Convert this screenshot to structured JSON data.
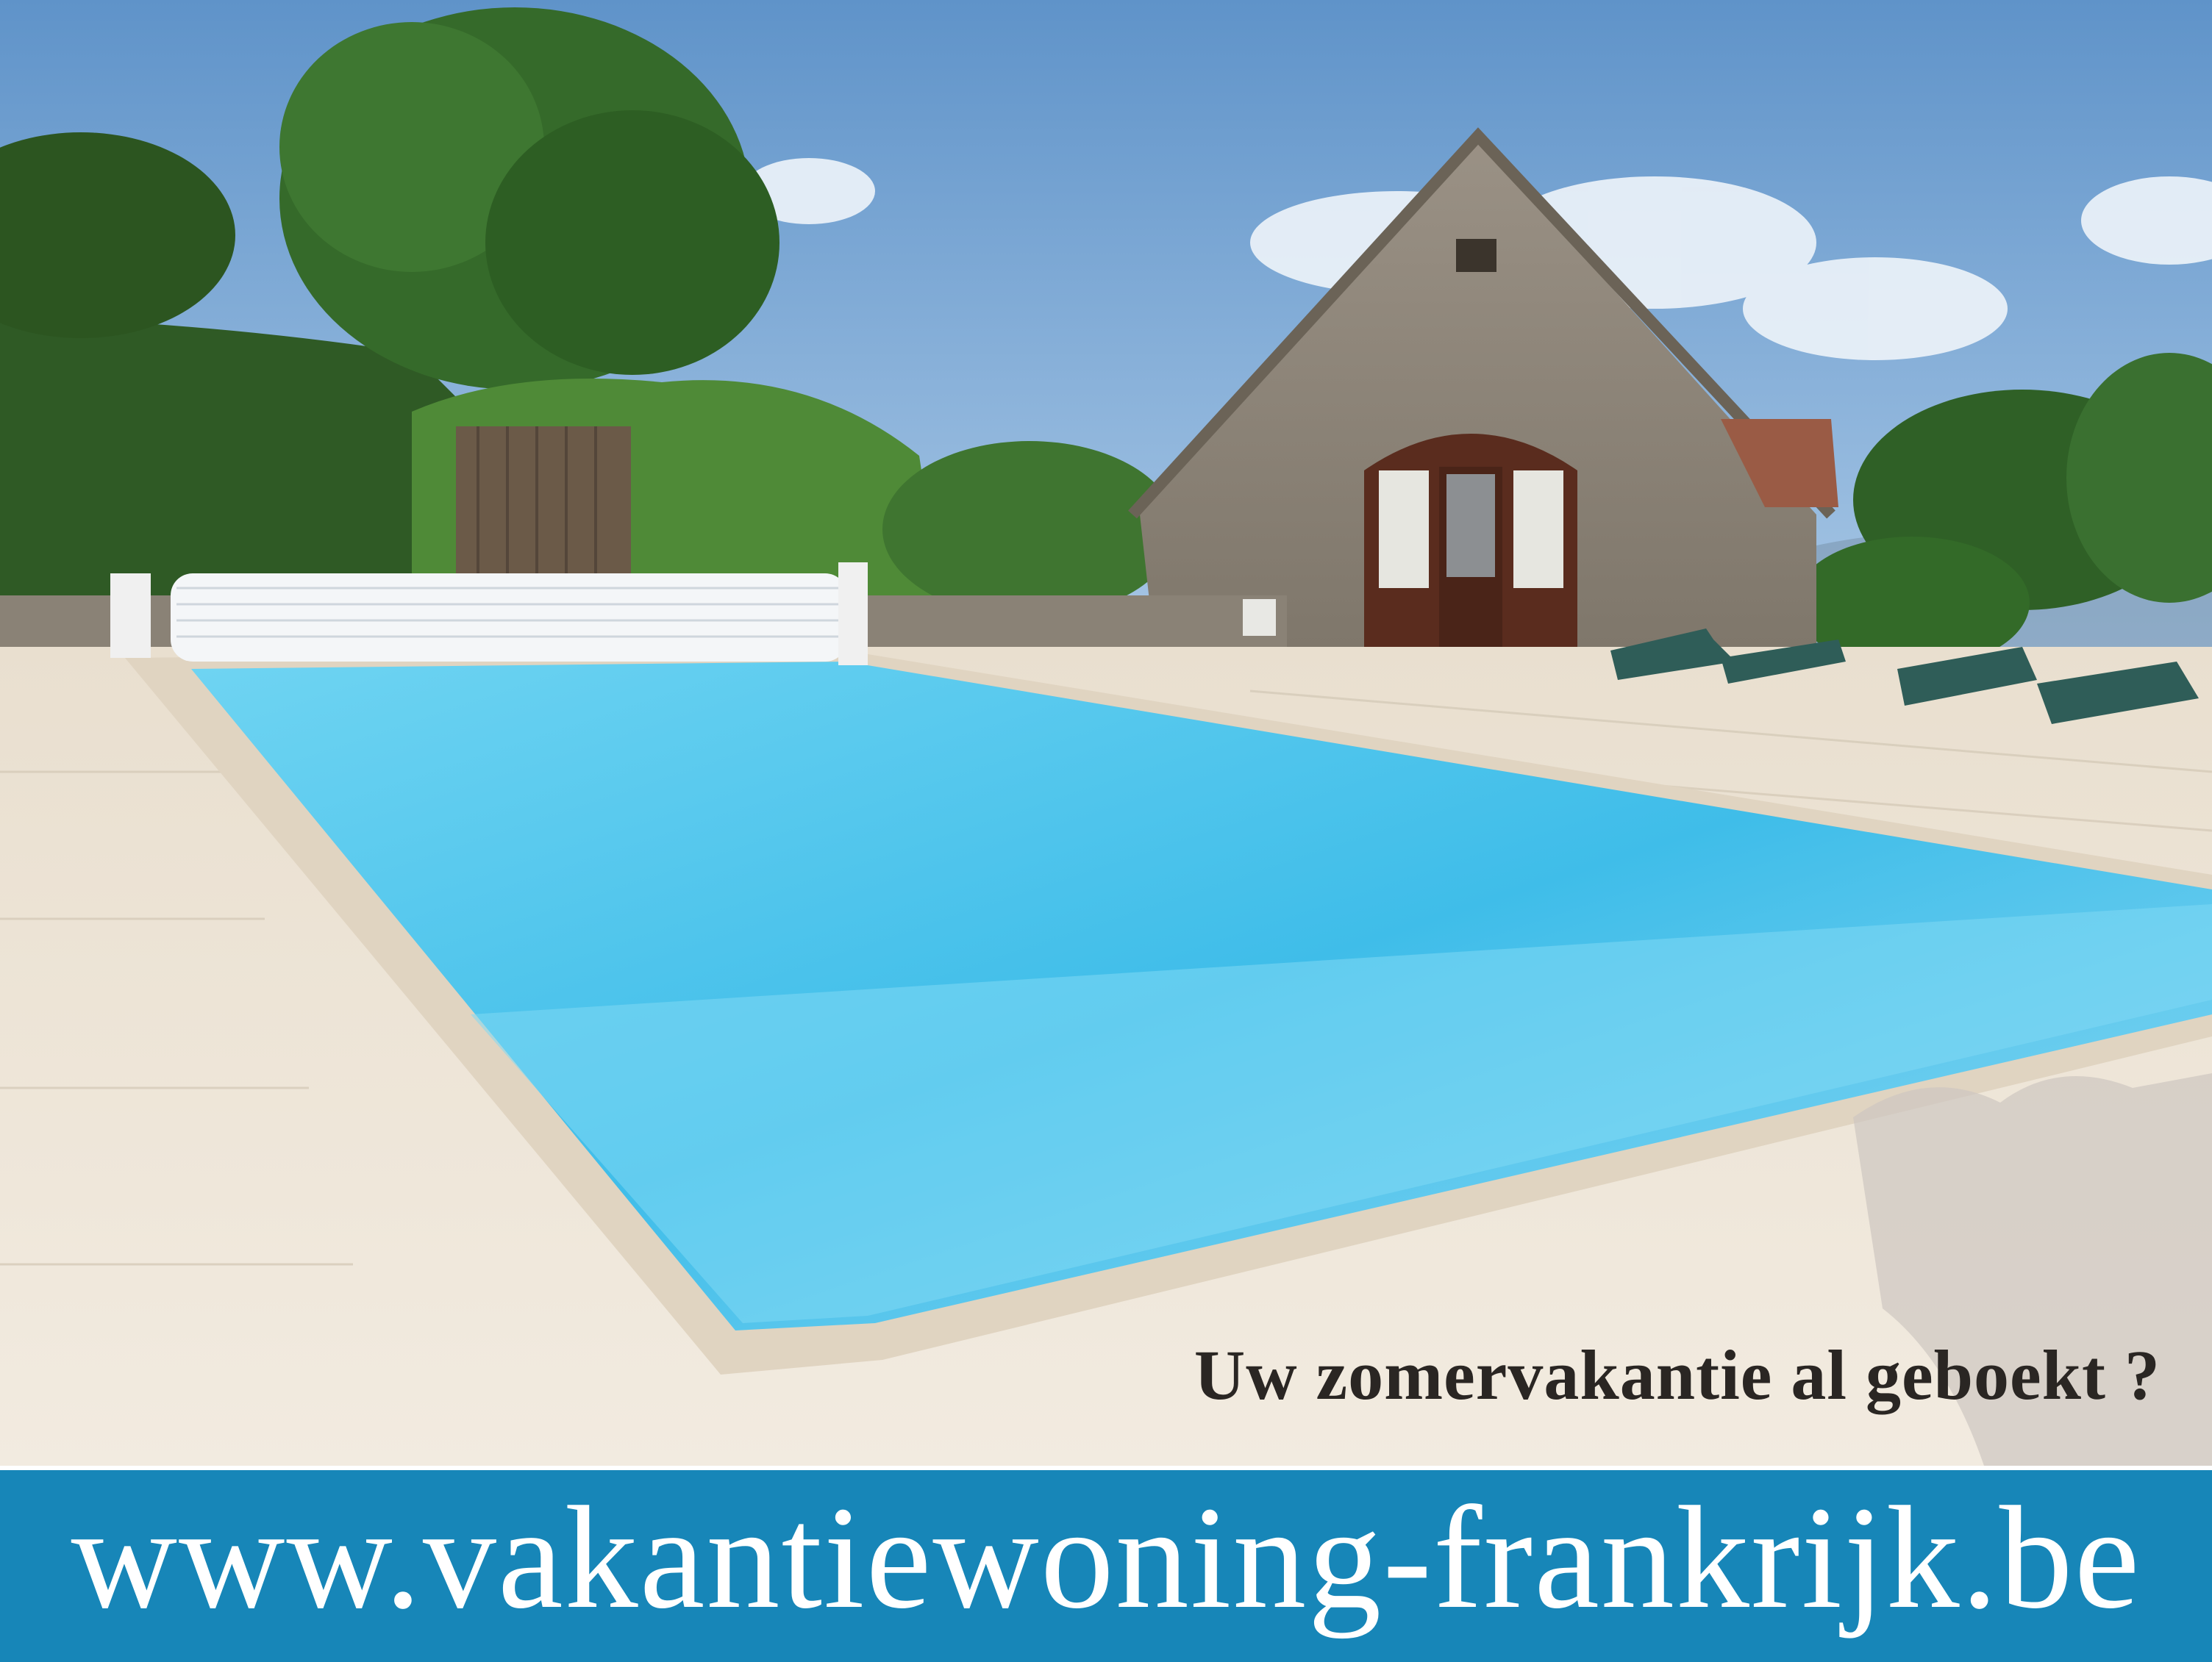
{
  "tagline": "Uw zomervakantie al geboekt ?",
  "banner": {
    "url_text": "www.vakantiewoning-frankrijk.be"
  },
  "colors": {
    "banner_blue": "#1786b8",
    "pool_water": "#4fc6ec",
    "sky": "#6e9fd0",
    "tagline_text": "#2a2623"
  }
}
